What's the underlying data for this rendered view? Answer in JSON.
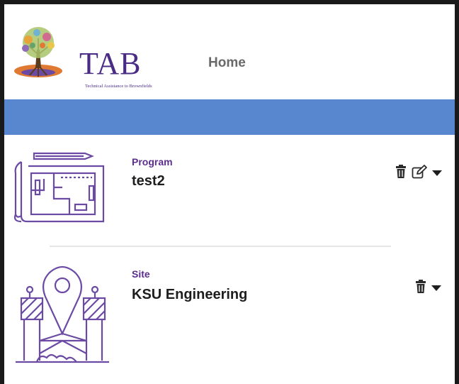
{
  "header": {
    "logo_text": "TAB",
    "logo_subtext": "Technical Assistance to Brownfields",
    "nav_home_label": "Home"
  },
  "colors": {
    "brand_purple": "#4a2c86",
    "accent_blue": "#5887cf",
    "type_label": "#5b2d8e"
  },
  "items": [
    {
      "type_label": "Program",
      "title": "test2",
      "illustration": "blueprint-icon",
      "actions": [
        "trash-icon",
        "edit-icon",
        "caret-down-icon"
      ]
    },
    {
      "type_label": "Site",
      "title": "KSU Engineering",
      "illustration": "site-location-icon",
      "actions": [
        "trash-icon",
        "caret-down-icon"
      ]
    }
  ]
}
